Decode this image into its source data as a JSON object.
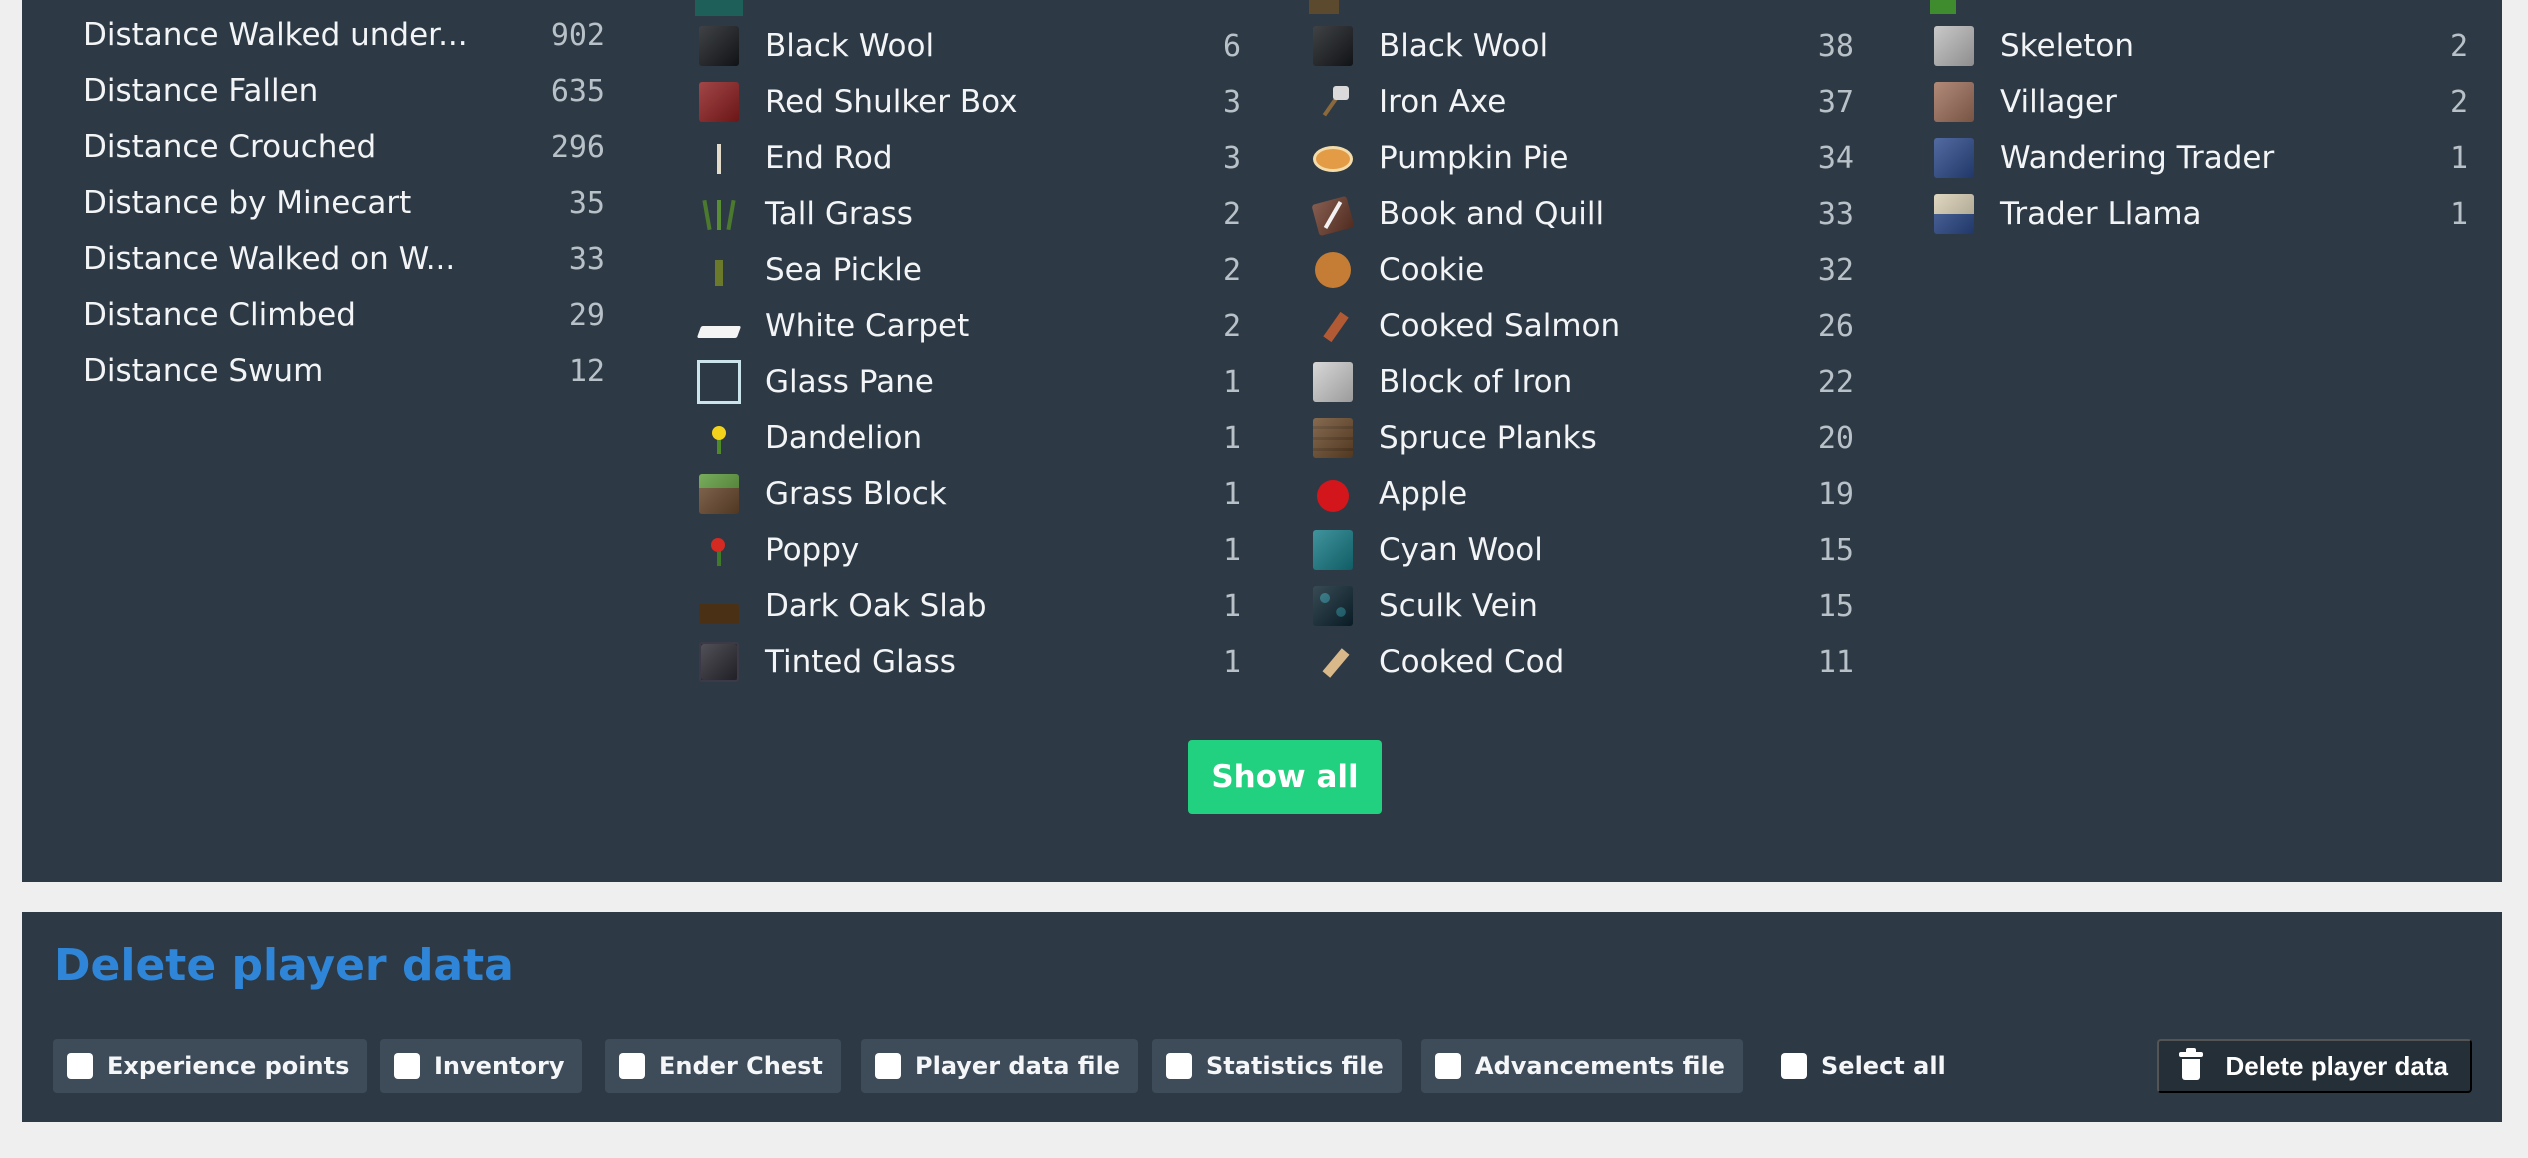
{
  "distance_stats": [
    {
      "label": "Distance Walked under...",
      "value": "902"
    },
    {
      "label": "Distance Fallen",
      "value": "635"
    },
    {
      "label": "Distance Crouched",
      "value": "296"
    },
    {
      "label": "Distance by Minecart",
      "value": "35"
    },
    {
      "label": "Distance Walked on W...",
      "value": "33"
    },
    {
      "label": "Distance Climbed",
      "value": "29"
    },
    {
      "label": "Distance Swum",
      "value": "12"
    }
  ],
  "column2_items": [
    {
      "icon": "black-wool-icon",
      "label": "Black Wool",
      "value": "6"
    },
    {
      "icon": "red-shulker-box-icon",
      "label": "Red Shulker Box",
      "value": "3"
    },
    {
      "icon": "end-rod-icon",
      "label": "End Rod",
      "value": "3"
    },
    {
      "icon": "tall-grass-icon",
      "label": "Tall Grass",
      "value": "2"
    },
    {
      "icon": "sea-pickle-icon",
      "label": "Sea Pickle",
      "value": "2"
    },
    {
      "icon": "white-carpet-icon",
      "label": "White Carpet",
      "value": "2"
    },
    {
      "icon": "glass-pane-icon",
      "label": "Glass Pane",
      "value": "1"
    },
    {
      "icon": "dandelion-icon",
      "label": "Dandelion",
      "value": "1"
    },
    {
      "icon": "grass-block-icon",
      "label": "Grass Block",
      "value": "1"
    },
    {
      "icon": "poppy-icon",
      "label": "Poppy",
      "value": "1"
    },
    {
      "icon": "dark-oak-slab-icon",
      "label": "Dark Oak Slab",
      "value": "1"
    },
    {
      "icon": "tinted-glass-icon",
      "label": "Tinted Glass",
      "value": "1"
    }
  ],
  "column3_items": [
    {
      "icon": "black-wool-icon",
      "label": "Black Wool",
      "value": "38"
    },
    {
      "icon": "iron-axe-icon",
      "label": "Iron Axe",
      "value": "37"
    },
    {
      "icon": "pumpkin-pie-icon",
      "label": "Pumpkin Pie",
      "value": "34"
    },
    {
      "icon": "book-and-quill-icon",
      "label": "Book and Quill",
      "value": "33"
    },
    {
      "icon": "cookie-icon",
      "label": "Cookie",
      "value": "32"
    },
    {
      "icon": "cooked-salmon-icon",
      "label": "Cooked Salmon",
      "value": "26"
    },
    {
      "icon": "block-of-iron-icon",
      "label": "Block of Iron",
      "value": "22"
    },
    {
      "icon": "spruce-planks-icon",
      "label": "Spruce Planks",
      "value": "20"
    },
    {
      "icon": "apple-icon",
      "label": "Apple",
      "value": "19"
    },
    {
      "icon": "cyan-wool-icon",
      "label": "Cyan Wool",
      "value": "15"
    },
    {
      "icon": "sculk-vein-icon",
      "label": "Sculk Vein",
      "value": "15"
    },
    {
      "icon": "cooked-cod-icon",
      "label": "Cooked Cod",
      "value": "11"
    }
  ],
  "column4_items": [
    {
      "icon": "skeleton-icon",
      "label": "Skeleton",
      "value": "2"
    },
    {
      "icon": "villager-icon",
      "label": "Villager",
      "value": "2"
    },
    {
      "icon": "wandering-trader-icon",
      "label": "Wandering Trader",
      "value": "1"
    },
    {
      "icon": "trader-llama-icon",
      "label": "Trader Llama",
      "value": "1"
    }
  ],
  "show_all_label": "Show all",
  "delete_section": {
    "title": "Delete player data",
    "options": [
      {
        "label": "Experience points"
      },
      {
        "label": "Inventory"
      },
      {
        "label": "Ender Chest"
      },
      {
        "label": "Player data file"
      },
      {
        "label": "Statistics file"
      },
      {
        "label": "Advancements file"
      },
      {
        "label": "Select all"
      }
    ],
    "delete_button_label": "Delete player data"
  },
  "colors": {
    "panel": "#2d3a45",
    "accent_green": "#22d17f",
    "title_blue": "#2f86d8",
    "page_bg": "#efefef"
  }
}
